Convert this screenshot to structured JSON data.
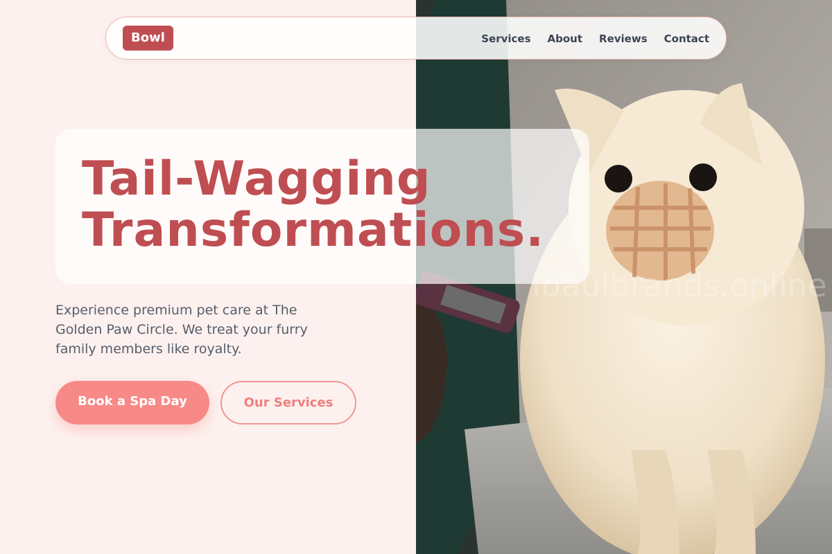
{
  "brand": {
    "logo_text": "Bowl"
  },
  "nav": {
    "links": [
      "Services",
      "About",
      "Reviews",
      "Contact"
    ]
  },
  "hero": {
    "title_line1": "Tail-Wagging",
    "title_line2": "Transformations.",
    "subtitle": "Experience premium pet care at The Golden Paw Circle. We treat your furry family members like royalty.",
    "primary_button": "Book a Spa Day",
    "secondary_button": "Our Services"
  },
  "photo": {
    "watermark": "ibaulbrands.online"
  },
  "colors": {
    "accent": "#bf4e52",
    "button_primary": "#f78987",
    "button_outline": "#f29593",
    "background": "#fdf1ef"
  }
}
